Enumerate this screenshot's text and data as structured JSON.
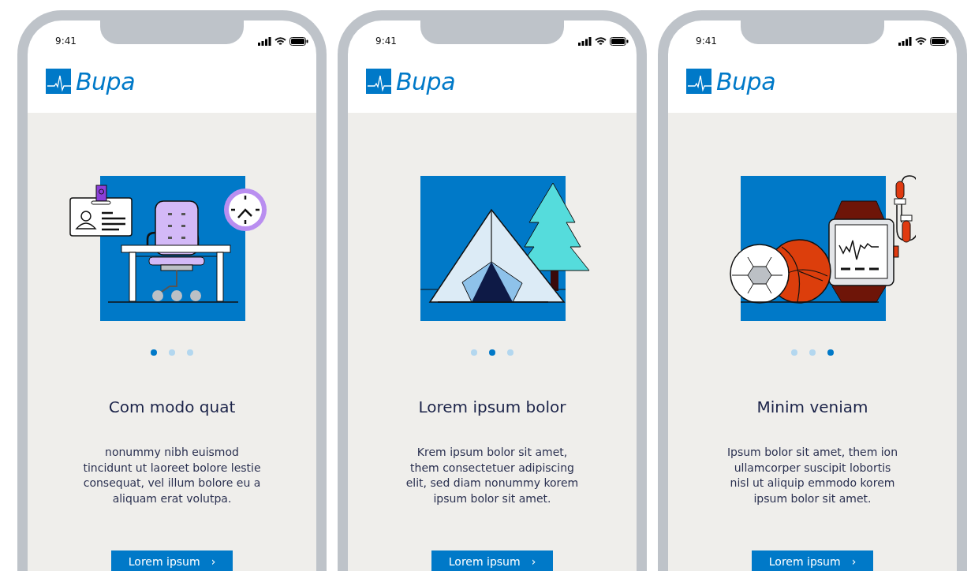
{
  "phones": [
    {
      "status_time": "9:41",
      "logo": "Bupa",
      "kind": "office",
      "dots": [
        {
          "selected": true
        },
        {
          "selected": false
        },
        {
          "selected": false
        }
      ],
      "title": "Com modo quat",
      "body": "nonummy nibh euismod tincidunt ut laoreet bolore lestie consequat, vel illum bolore eu a aliquam erat volutpa.",
      "button": {
        "label": "Lorem ipsum",
        "chevron": "›"
      }
    },
    {
      "status_time": "9:41",
      "logo": "Bupa",
      "kind": "camping",
      "dots": [
        {
          "selected": false
        },
        {
          "selected": true
        },
        {
          "selected": false
        }
      ],
      "title": "Lorem ipsum bolor",
      "body": "Krem ipsum bolor sit amet, them consectetuer adipiscing elit, sed diam nonummy korem ipsum bolor sit amet.",
      "button": {
        "label": "Lorem ipsum",
        "chevron": "›"
      }
    },
    {
      "status_time": "9:41",
      "logo": "Bupa",
      "kind": "fitness",
      "dots": [
        {
          "selected": false
        },
        {
          "selected": false
        },
        {
          "selected": true
        }
      ],
      "title": "Minim veniam",
      "body": "Ipsum bolor sit amet, them ion ullamcorper suscipit lobortis nisl ut aliquip emmodo korem ipsum bolor sit amet.",
      "button": {
        "label": "Lorem ipsum",
        "chevron": "›"
      }
    }
  ]
}
